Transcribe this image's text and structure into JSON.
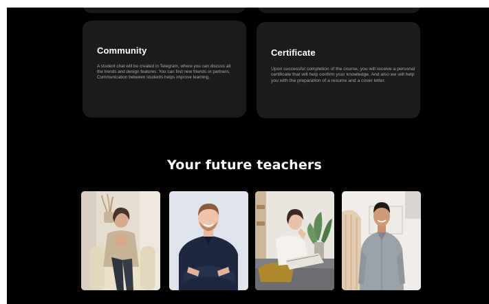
{
  "features": {
    "community": {
      "title": "Community",
      "text": "A student chat will be created in Telegram, where you can discuss all the trends and design features. You can find new friends or partners. Communication between students helps improve learning."
    },
    "certificate": {
      "title": "Certificate",
      "text": "Upon successful completion of the course, you will receive a personal certificate that will help confirm your knowledge. And also we will help you with the preparation of a resume and a cover letter."
    }
  },
  "teachers_section": {
    "title": "Your future teachers",
    "photos": [
      {
        "subject": "woman-seated-beige-armchair"
      },
      {
        "subject": "smiling-man-navy-shirt-arms-crossed"
      },
      {
        "subject": "woman-lounging-reading-magazine"
      },
      {
        "subject": "man-standing-grey-shirt"
      }
    ]
  },
  "colors": {
    "page_background": "#000000",
    "card_background": "#1b1b1b",
    "heading": "#ffffff",
    "body_text": "#a8a8a8"
  }
}
